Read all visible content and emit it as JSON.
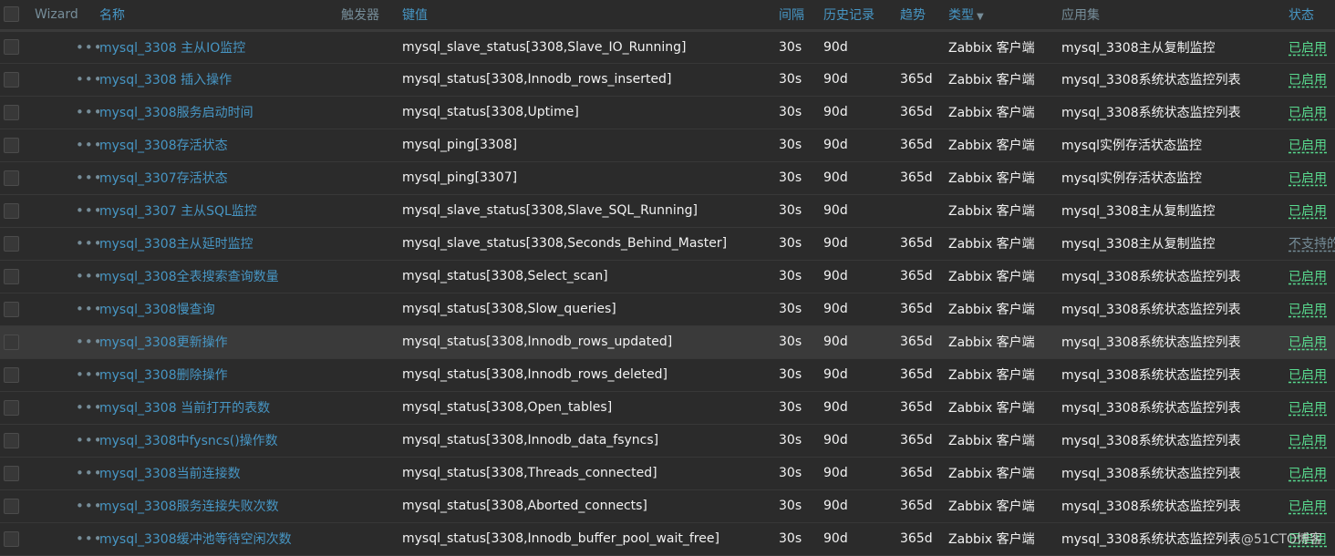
{
  "header": {
    "wizard": "Wizard",
    "name": "名称",
    "triggers": "触发器",
    "key": "键值",
    "interval": "间隔",
    "history": "历史记录",
    "trends": "趋势",
    "type": "类型",
    "applications": "应用集",
    "status": "状态"
  },
  "colors": {
    "link": "#4796c4",
    "enabled": "#59db8f",
    "muted": "#768d99",
    "background": "#2b2b2b"
  },
  "rows": [
    {
      "name": "mysql_3308 主从IO监控",
      "key": "mysql_slave_status[3308,Slave_IO_Running]",
      "interval": "30s",
      "history": "90d",
      "trends": "",
      "type": "Zabbix 客户端",
      "app": "mysql_3308主从复制监控",
      "status": "已启用"
    },
    {
      "name": "mysql_3308 插入操作",
      "key": "mysql_status[3308,Innodb_rows_inserted]",
      "interval": "30s",
      "history": "90d",
      "trends": "365d",
      "type": "Zabbix 客户端",
      "app": "mysql_3308系统状态监控列表",
      "status": "已启用"
    },
    {
      "name": "mysql_3308服务启动时间",
      "key": "mysql_status[3308,Uptime]",
      "interval": "30s",
      "history": "90d",
      "trends": "365d",
      "type": "Zabbix 客户端",
      "app": "mysql_3308系统状态监控列表",
      "status": "已启用"
    },
    {
      "name": "mysql_3308存活状态",
      "key": "mysql_ping[3308]",
      "interval": "30s",
      "history": "90d",
      "trends": "365d",
      "type": "Zabbix 客户端",
      "app": "mysql实例存活状态监控",
      "status": "已启用"
    },
    {
      "name": "mysql_3307存活状态",
      "key": "mysql_ping[3307]",
      "interval": "30s",
      "history": "90d",
      "trends": "365d",
      "type": "Zabbix 客户端",
      "app": "mysql实例存活状态监控",
      "status": "已启用"
    },
    {
      "name": "mysql_3307 主从SQL监控",
      "key": "mysql_slave_status[3308,Slave_SQL_Running]",
      "interval": "30s",
      "history": "90d",
      "trends": "",
      "type": "Zabbix 客户端",
      "app": "mysql_3308主从复制监控",
      "status": "已启用"
    },
    {
      "name": "mysql_3308主从延时监控",
      "key": "mysql_slave_status[3308,Seconds_Behind_Master]",
      "interval": "30s",
      "history": "90d",
      "trends": "365d",
      "type": "Zabbix 客户端",
      "app": "mysql_3308主从复制监控",
      "status": "不支持的"
    },
    {
      "name": "mysql_3308全表搜索查询数量",
      "key": "mysql_status[3308,Select_scan]",
      "interval": "30s",
      "history": "90d",
      "trends": "365d",
      "type": "Zabbix 客户端",
      "app": "mysql_3308系统状态监控列表",
      "status": "已启用"
    },
    {
      "name": "mysql_3308慢查询",
      "key": "mysql_status[3308,Slow_queries]",
      "interval": "30s",
      "history": "90d",
      "trends": "365d",
      "type": "Zabbix 客户端",
      "app": "mysql_3308系统状态监控列表",
      "status": "已启用"
    },
    {
      "name": "mysql_3308更新操作",
      "key": "mysql_status[3308,Innodb_rows_updated]",
      "interval": "30s",
      "history": "90d",
      "trends": "365d",
      "type": "Zabbix 客户端",
      "app": "mysql_3308系统状态监控列表",
      "status": "已启用"
    },
    {
      "name": "mysql_3308删除操作",
      "key": "mysql_status[3308,Innodb_rows_deleted]",
      "interval": "30s",
      "history": "90d",
      "trends": "365d",
      "type": "Zabbix 客户端",
      "app": "mysql_3308系统状态监控列表",
      "status": "已启用"
    },
    {
      "name": "mysql_3308 当前打开的表数",
      "key": "mysql_status[3308,Open_tables]",
      "interval": "30s",
      "history": "90d",
      "trends": "365d",
      "type": "Zabbix 客户端",
      "app": "mysql_3308系统状态监控列表",
      "status": "已启用"
    },
    {
      "name": "mysql_3308中fysncs()操作数",
      "key": "mysql_status[3308,Innodb_data_fsyncs]",
      "interval": "30s",
      "history": "90d",
      "trends": "365d",
      "type": "Zabbix 客户端",
      "app": "mysql_3308系统状态监控列表",
      "status": "已启用"
    },
    {
      "name": "mysql_3308当前连接数",
      "key": "mysql_status[3308,Threads_connected]",
      "interval": "30s",
      "history": "90d",
      "trends": "365d",
      "type": "Zabbix 客户端",
      "app": "mysql_3308系统状态监控列表",
      "status": "已启用"
    },
    {
      "name": "mysql_3308服务连接失败次数",
      "key": "mysql_status[3308,Aborted_connects]",
      "interval": "30s",
      "history": "90d",
      "trends": "365d",
      "type": "Zabbix 客户端",
      "app": "mysql_3308系统状态监控列表",
      "status": "已启用"
    },
    {
      "name": "mysql_3308缓冲池等待空闲次数",
      "key": "mysql_status[3308,Innodb_buffer_pool_wait_free]",
      "interval": "30s",
      "history": "90d",
      "trends": "365d",
      "type": "Zabbix 客户端",
      "app": "mysql_3308系统状态监控列表",
      "status": "已启用"
    }
  ],
  "hover_row": 9,
  "watermark": "@51CTO博客"
}
